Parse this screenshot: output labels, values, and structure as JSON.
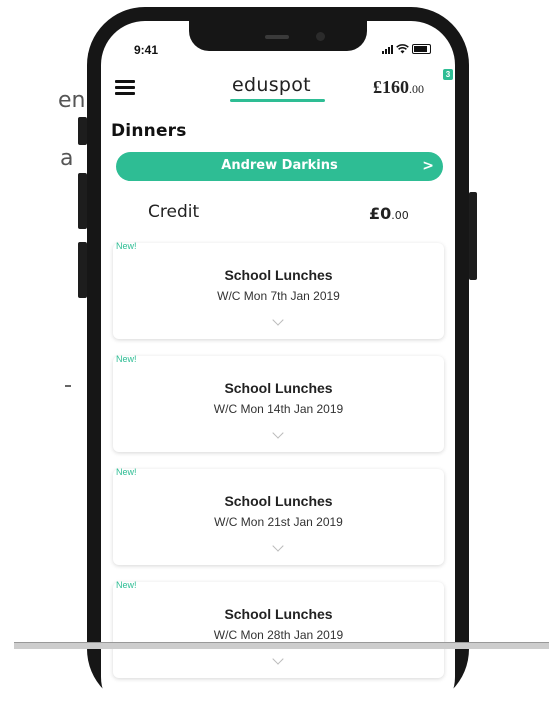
{
  "background_text": {
    "line1": "en",
    "line2": "a"
  },
  "status_bar": {
    "time": "9:41"
  },
  "header": {
    "logo": "eduspot",
    "balance_main": "£160",
    "balance_pence": ".00",
    "notification_count": "3"
  },
  "page": {
    "title": "Dinners"
  },
  "student": {
    "name": "Andrew Darkins",
    "chevron": ">"
  },
  "credit": {
    "label": "Credit",
    "amount_main": "£0",
    "amount_pence": ".00"
  },
  "cards": [
    {
      "badge": "New!",
      "title": "School Lunches",
      "subtitle": "W/C Mon 7th Jan 2019"
    },
    {
      "badge": "New!",
      "title": "School Lunches",
      "subtitle": "W/C Mon 14th Jan 2019"
    },
    {
      "badge": "New!",
      "title": "School Lunches",
      "subtitle": "W/C Mon 21st Jan 2019"
    },
    {
      "badge": "New!",
      "title": "School Lunches",
      "subtitle": "W/C Mon 28th Jan 2019"
    }
  ],
  "colors": {
    "accent": "#2ebd94",
    "frame": "#161616"
  }
}
